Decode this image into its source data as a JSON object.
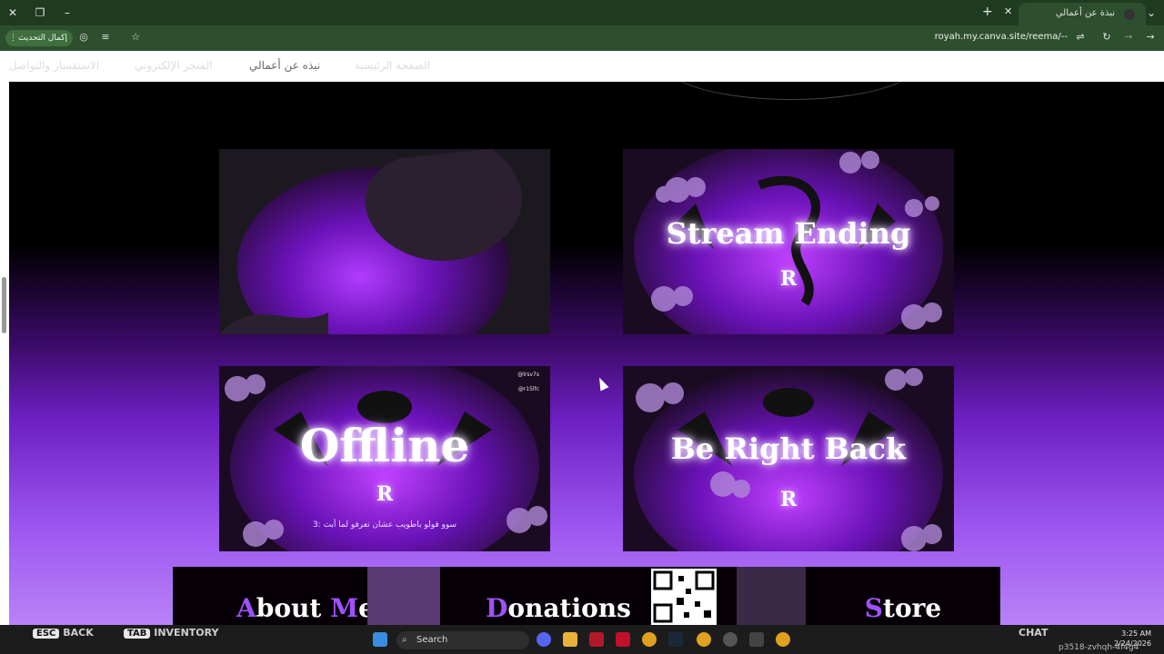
{
  "browser": {
    "tab_title": "نبذة عن أعمالي",
    "url": "royah.my.canva.site/reema/--",
    "update_button": "إكمال التحديث"
  },
  "site_nav": {
    "items": [
      {
        "label": "الصفحة الرئيسية"
      },
      {
        "label": "نبذه عن أعمالي"
      },
      {
        "label": "المتجر الإلكتروني"
      },
      {
        "label": "الاستفسار والتواصل"
      }
    ]
  },
  "gallery": {
    "cards": [
      {
        "title": "",
        "monogram": "",
        "subtitle": ""
      },
      {
        "title": "Stream Ending",
        "monogram": "R",
        "subtitle": ""
      },
      {
        "title": "Offline",
        "monogram": "R",
        "subtitle": "سوو فولو باطويب عشان تعرفو لما أبث :3",
        "handle1": "@lrsv7s",
        "handle2": "@r15lfc"
      },
      {
        "title": "Be Right Back",
        "monogram": "R",
        "subtitle": ""
      }
    ]
  },
  "bottom_strip": {
    "about": {
      "cap1": "A",
      "rest1": "bout ",
      "cap2": "M",
      "rest2": "e"
    },
    "donations": {
      "cap": "D",
      "rest": "onations"
    },
    "store": {
      "cap": "S",
      "rest": "tore"
    }
  },
  "taskbar": {
    "search_placeholder": "Search",
    "overlay_esc": "ESC",
    "overlay_back": "BACK",
    "overlay_tab": "TAB",
    "overlay_inventory": "INVENTORY",
    "overlay_chat": "CHAT",
    "time": "3:25 AM",
    "date": "2/24/2026",
    "overlay_id": "p3518-zvhqh-4f4g4"
  },
  "colors": {
    "accent_purple": "#8a2be2",
    "browser_green": "#2d4f2d"
  }
}
